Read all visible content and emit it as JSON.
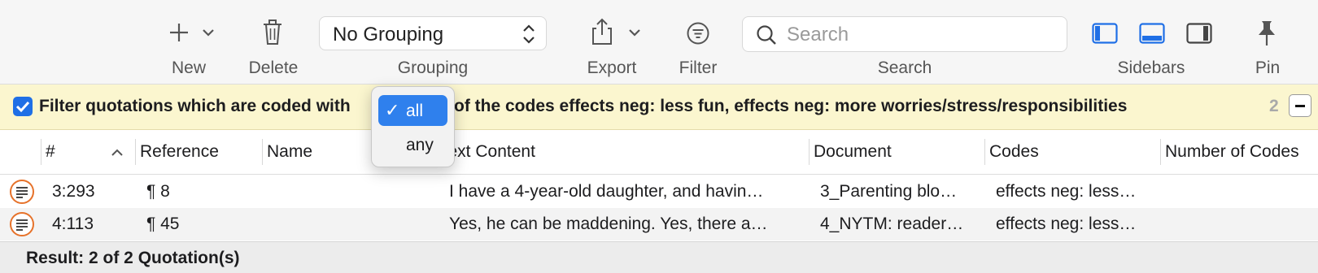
{
  "toolbar": {
    "new_label": "New",
    "delete_label": "Delete",
    "grouping_label": "Grouping",
    "grouping_value": "No Grouping",
    "export_label": "Export",
    "filter_label": "Filter",
    "search_label": "Search",
    "search_placeholder": "Search",
    "sidebars_label": "Sidebars",
    "pin_label": "Pin",
    "accent_color": "#1f6fe6"
  },
  "filter_bar": {
    "enabled": true,
    "text_before": "Filter quotations which are coded with",
    "text_after": "of the codes effects neg: less fun, effects neg: more worries/stress/responsibilities",
    "count": "2",
    "background_color": "#fbf6cf"
  },
  "match_menu": {
    "options": [
      {
        "label": "all",
        "selected": true
      },
      {
        "label": "any",
        "selected": false
      }
    ]
  },
  "table": {
    "columns": [
      "#",
      "Reference",
      "Name",
      "Text Content",
      "Document",
      "Codes",
      "Number of Codes"
    ],
    "sort_column": "#",
    "sort_direction": "ascending",
    "rows": [
      {
        "id": "3:293",
        "reference": "¶ 8",
        "name": "",
        "text": "I have a 4-year-old daughter, and havin…",
        "document": "3_Parenting blo…",
        "codes": "effects neg: less…",
        "num_codes": ""
      },
      {
        "id": "4:113",
        "reference": "¶ 45",
        "name": "",
        "text": "Yes, he can be maddening. Yes, there a…",
        "document": "4_NYTM: reader…",
        "codes": "effects neg: less…",
        "num_codes": ""
      }
    ]
  },
  "footer": {
    "result_text": "Result: 2 of 2 Quotation(s)"
  }
}
